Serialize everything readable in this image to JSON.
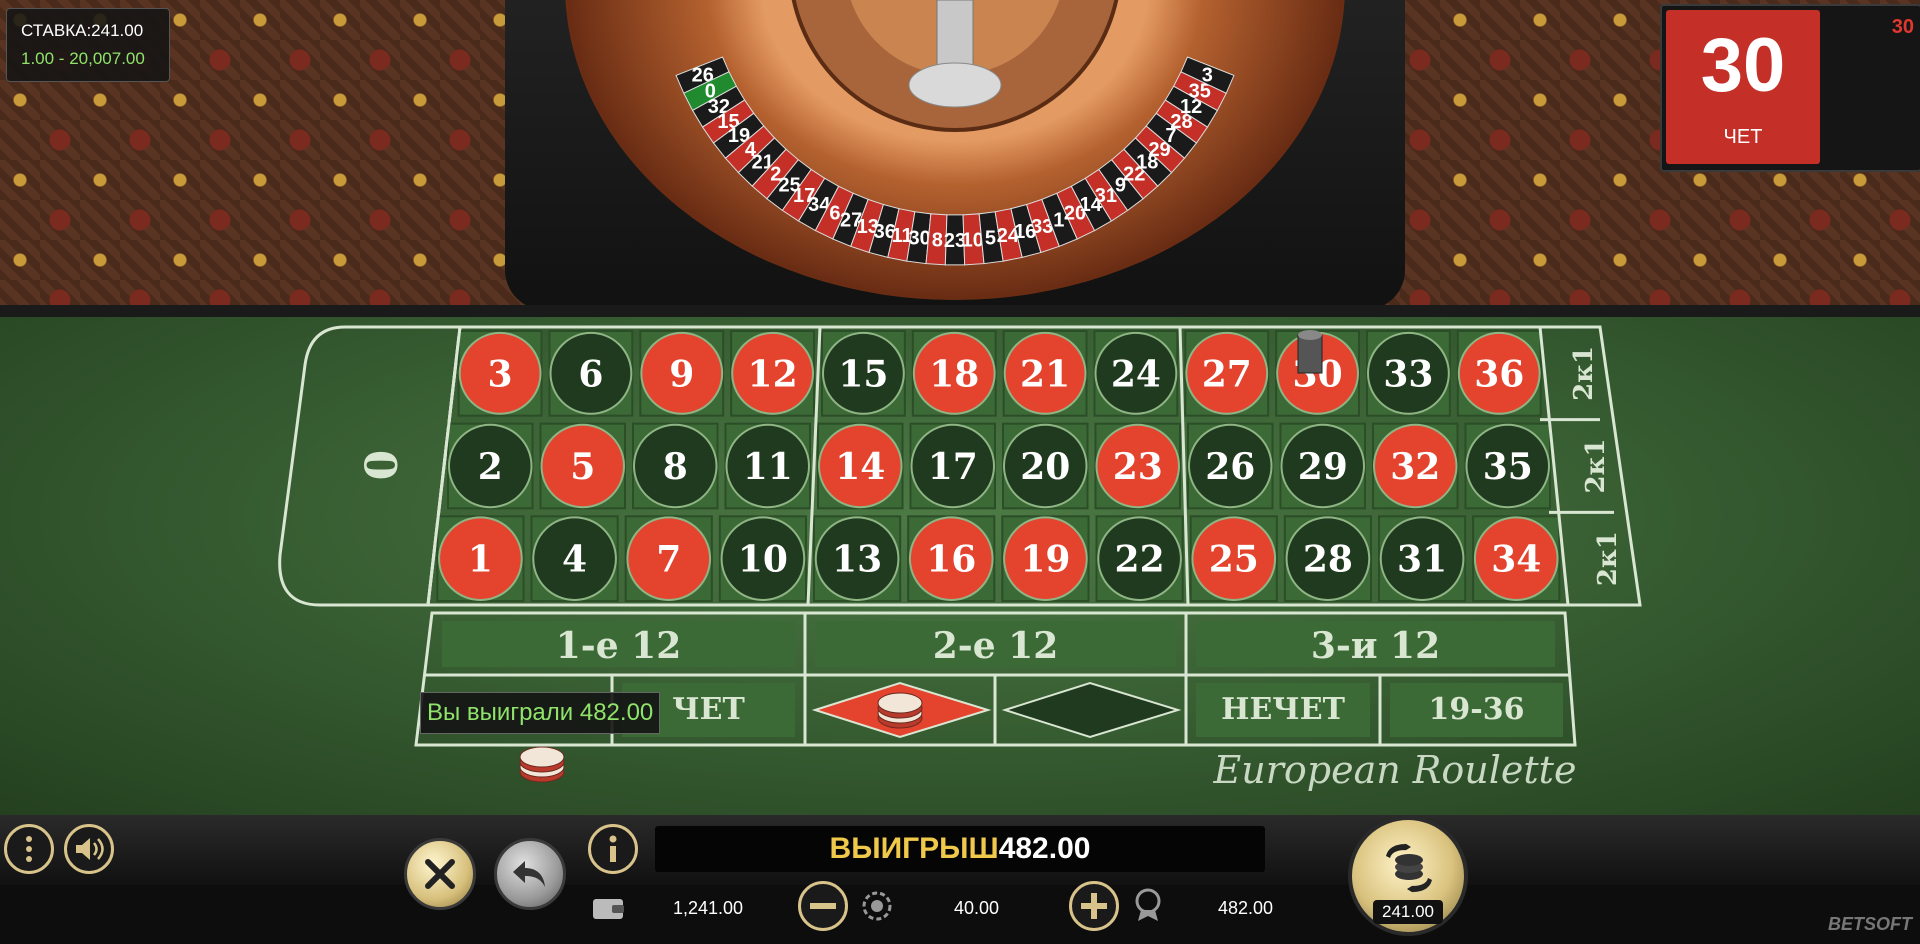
{
  "header": {
    "bet_text": "СТАВКА:241.00",
    "range_text": "1.00 - 20,007.00"
  },
  "result": {
    "number": "30",
    "label": "ЧЕТ",
    "history_last": "30"
  },
  "board": {
    "zero": "0",
    "rows": [
      [
        {
          "n": "3",
          "c": "red"
        },
        {
          "n": "6",
          "c": "black"
        },
        {
          "n": "9",
          "c": "red"
        },
        {
          "n": "12",
          "c": "red"
        },
        {
          "n": "15",
          "c": "black"
        },
        {
          "n": "18",
          "c": "red"
        },
        {
          "n": "21",
          "c": "red"
        },
        {
          "n": "24",
          "c": "black"
        },
        {
          "n": "27",
          "c": "red"
        },
        {
          "n": "30",
          "c": "red"
        },
        {
          "n": "33",
          "c": "black"
        },
        {
          "n": "36",
          "c": "red"
        }
      ],
      [
        {
          "n": "2",
          "c": "black"
        },
        {
          "n": "5",
          "c": "red"
        },
        {
          "n": "8",
          "c": "black"
        },
        {
          "n": "11",
          "c": "black"
        },
        {
          "n": "14",
          "c": "red"
        },
        {
          "n": "17",
          "c": "black"
        },
        {
          "n": "20",
          "c": "black"
        },
        {
          "n": "23",
          "c": "red"
        },
        {
          "n": "26",
          "c": "black"
        },
        {
          "n": "29",
          "c": "black"
        },
        {
          "n": "32",
          "c": "red"
        },
        {
          "n": "35",
          "c": "black"
        }
      ],
      [
        {
          "n": "1",
          "c": "red"
        },
        {
          "n": "4",
          "c": "black"
        },
        {
          "n": "7",
          "c": "red"
        },
        {
          "n": "10",
          "c": "black"
        },
        {
          "n": "13",
          "c": "black"
        },
        {
          "n": "16",
          "c": "red"
        },
        {
          "n": "19",
          "c": "red"
        },
        {
          "n": "22",
          "c": "black"
        },
        {
          "n": "25",
          "c": "red"
        },
        {
          "n": "28",
          "c": "black"
        },
        {
          "n": "31",
          "c": "black"
        },
        {
          "n": "34",
          "c": "red"
        }
      ]
    ],
    "column_labels": [
      "2к1",
      "2к1",
      "2к1"
    ],
    "dozens": [
      "1-е 12",
      "2-е 12",
      "3-и 12"
    ],
    "outside": [
      "",
      "ЧЕТ",
      "",
      "",
      "НЕЧЕТ",
      "19-36"
    ],
    "table_name": "European Roulette"
  },
  "wheel_numbers": [
    "26",
    "0",
    "32",
    "15",
    "19",
    "4",
    "21",
    "2",
    "25",
    "17",
    "34",
    "6",
    "27",
    "13",
    "36",
    "11",
    "30",
    "8",
    "23",
    "10",
    "5",
    "24",
    "16",
    "33",
    "1",
    "20",
    "14",
    "31",
    "9",
    "22",
    "18",
    "29",
    "7",
    "28",
    "12",
    "35",
    "3"
  ],
  "tooltip": {
    "win_text": "Вы выиграли 482.00"
  },
  "bottom": {
    "win_label": "ВЫИГРЫШ",
    "win_value": "482.00",
    "balance": "1,241.00",
    "chip_value": "40.00",
    "last_win": "482.00",
    "spin_amount": "241.00",
    "logo": "BETSOFT"
  },
  "colors": {
    "red": "#e4442e",
    "black": "#1f3a1e",
    "felt": "#3f6a38",
    "line": "#d9e6d2",
    "gold": "#f0c84a",
    "win_green": "#8fe36a"
  }
}
